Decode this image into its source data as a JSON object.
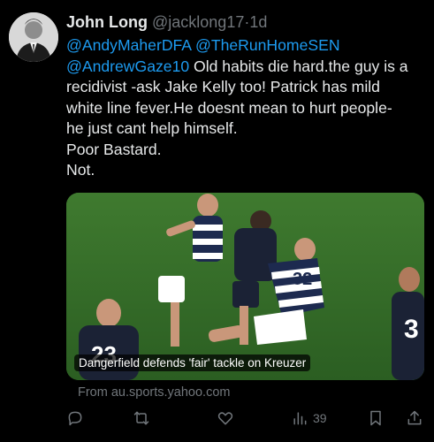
{
  "tweet": {
    "author_name": "John Long",
    "handle": "@jacklong17",
    "separator": "·",
    "time": "1d",
    "mentions": [
      "@AndyMaherDFA",
      "@TheRunHomeSEN",
      "@AndrewGaze10"
    ],
    "text_after_mentions": "Old habits die hard.the guy is a",
    "lines": [
      "recidivist -ask Jake Kelly too! Patrick has mild",
      "white line fever.He doesnt mean to hurt people-",
      "he just cant help himself.",
      "Poor Bastard.",
      "Not."
    ]
  },
  "card": {
    "caption": "Dangerfield defends 'fair' tackle on Kreuzer",
    "source": "From au.sports.yahoo.com",
    "jersey_numbers": [
      "32",
      "3",
      "23"
    ]
  },
  "actions": {
    "views_count": "39"
  },
  "colors": {
    "background": "#000000",
    "text": "#e7e9ea",
    "muted": "#71767b",
    "link": "#1d9bf0"
  },
  "icons": [
    "reply-icon",
    "retweet-icon",
    "like-icon",
    "views-icon",
    "bookmark-icon",
    "share-icon"
  ]
}
